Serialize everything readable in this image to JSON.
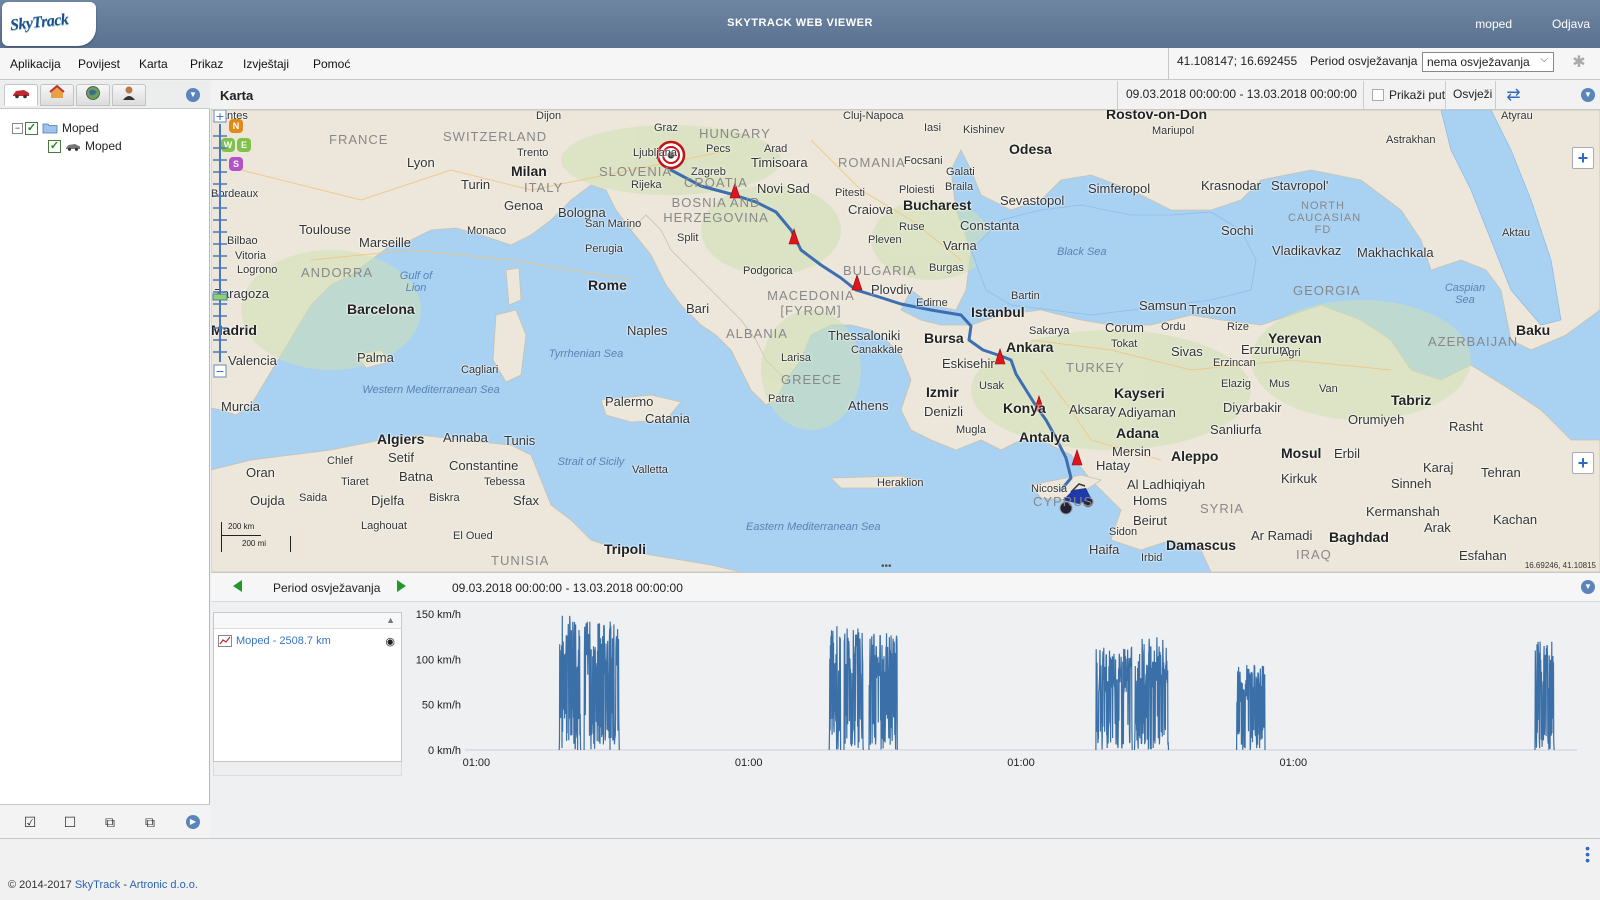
{
  "header": {
    "logo_text": "SkyTrack",
    "title": "SKYTRACK WEB VIEWER",
    "user": "moped",
    "logout": "Odjava"
  },
  "menu": {
    "items": [
      "Aplikacija",
      "Povijest",
      "Karta",
      "Prikaz",
      "Izvještaji",
      "Pomoć"
    ],
    "coordinates": "41.108147; 16.692455",
    "refresh_label": "Period osvježavanja",
    "refresh_value": "nema osvježavanja"
  },
  "left_panel": {
    "tabs": [
      "vehicles-tab",
      "places-tab",
      "zones-tab",
      "users-tab"
    ],
    "tree": {
      "group": "Moped",
      "vehicle": "Moped"
    }
  },
  "map_panel": {
    "title": "Karta",
    "period": "09.03.2018 00:00:00 - 13.03.2018 00:00:00",
    "show_path_label": "Prikaži put",
    "refresh_button": "Osvježi",
    "scale_km": "200 km",
    "scale_mi": "200 mi",
    "cursor_coords": "16.69246, 41.10815",
    "compass": [
      "N",
      "W",
      "E",
      "S"
    ],
    "labels": {
      "cities": [
        "Nantes",
        "Dijon",
        "Graz",
        "Cluj-Napoca",
        "Iasi",
        "Kishinev",
        "Odesa",
        "Rostov-on-Don",
        "Mariupol",
        "Atyrau",
        "Astrakhan",
        "Lyon",
        "Milan",
        "Trento",
        "Ljubljana",
        "Rijeka",
        "Zagreb",
        "Pecs",
        "Arad",
        "Timisoara",
        "Focsani",
        "Galati",
        "Braila",
        "Turin",
        "Genoa",
        "Bologna",
        "San Marino",
        "Novi Sad",
        "Pitesti",
        "Ploiesti",
        "Craiova",
        "Bucharest",
        "Constanta",
        "Sevastopol",
        "Simferopol",
        "Krasnodar",
        "Stavropol'",
        "Bordeaux",
        "Toulouse",
        "Marseille",
        "Monaco",
        "Split",
        "Pleven",
        "Ruse",
        "Varna",
        "Sochi",
        "Vladikavkaz",
        "Makhachkala",
        "Aktau",
        "Bilbao",
        "Vitoria",
        "Logrono",
        "Perugia",
        "Podgorica",
        "Burgas",
        "Zaragoza",
        "Rome",
        "Plovdiv",
        "Edirne",
        "Bartin",
        "Samsun",
        "Trabzon",
        "Barcelona",
        "Bari",
        "Istanbul",
        "Corum",
        "Ordu",
        "Rize",
        "Madrid",
        "Naples",
        "Thessaloniki",
        "Canakkale",
        "Sakarya",
        "Tokat",
        "Sivas",
        "Erzurum",
        "Yerevan",
        "Baku",
        "Valencia",
        "Palma",
        "Larisa",
        "Bursa",
        "Ankara",
        "Erzincan",
        "Agri",
        "Eskisehir",
        "Cagliari",
        "Izmir",
        "Usak",
        "Kayseri",
        "Elazig",
        "Mus",
        "Van",
        "Murcia",
        "Palermo",
        "Patra",
        "Athens",
        "Denizli",
        "Konya",
        "Aksaray",
        "Adiyaman",
        "Diyarbakir",
        "Tabriz",
        "Catania",
        "Mugla",
        "Antalya",
        "Adana",
        "Sanliurfa",
        "Orumiyeh",
        "Rasht",
        "Algiers",
        "Annaba",
        "Tunis",
        "Mersin",
        "Hatay",
        "Aleppo",
        "Mosul",
        "Erbil",
        "Karaj",
        "Tehran",
        "Oran",
        "Chlef",
        "Setif",
        "Batna",
        "Constantine",
        "Valletta",
        "Kirkuk",
        "Sinneh",
        "Tiaret",
        "Tebessa",
        "Heraklion",
        "Nicosia",
        "Al Ladhiqiyah",
        "Oujda",
        "Saida",
        "Djelfa",
        "Biskra",
        "Sfax",
        "Homs",
        "Kermanshah",
        "Arak",
        "Kachan",
        "Laghouat",
        "El Oued",
        "Beirut",
        "Sidon",
        "Haifa",
        "Damascus",
        "Irbid",
        "Ar Ramadi",
        "Baghdad",
        "Esfahan",
        "Tripoli"
      ],
      "countries": [
        "FRANCE",
        "SWITZERLAND",
        "HUNGARY",
        "ROMANIA",
        "ITALY",
        "SLOVENIA",
        "CROATIA",
        "BOSNIA AND HERZEGOVINA",
        "ANDORRA",
        "BULGARIA",
        "MACEDONIA [FYROM]",
        "ALBANIA",
        "GREECE",
        "TURKEY",
        "GEORGIA",
        "AZERBAIJAN",
        "NORTH CAUCASIAN FD",
        "SYRIA",
        "IRAQ",
        "TUNISIA",
        "CYPRUS"
      ],
      "seas": [
        "Gulf of Lion",
        "Tyrrhenian Sea",
        "Western Mediterranean Sea",
        "Strait of Sicily",
        "Eastern Mediterranean Sea",
        "Black Sea",
        "Caspian Sea"
      ]
    }
  },
  "chart_panel": {
    "period_label": "Period osvježavanja",
    "period": "09.03.2018 00:00:00 - 13.03.2018 00:00:00",
    "legend_entry": "Moped - 2508.7 km"
  },
  "chart_data": {
    "type": "line",
    "title": "",
    "xlabel": "",
    "ylabel": "",
    "y_ticks": [
      "0 km/h",
      "50 km/h",
      "100 km/h",
      "150 km/h"
    ],
    "ylim": [
      0,
      150
    ],
    "x_ticks": [
      "01:00",
      "01:00",
      "01:00",
      "01:00"
    ],
    "x_tick_hours": [
      1,
      25,
      49,
      73
    ],
    "xlim_hours": [
      0,
      98
    ],
    "series": [
      {
        "name": "Moped",
        "color": "#3a6fa8",
        "driving_segments_hours": [
          [
            8.3,
            10.2,
            150
          ],
          [
            10.5,
            13.6,
            142
          ],
          [
            32.1,
            33.1,
            145
          ],
          [
            33.4,
            35.1,
            135
          ],
          [
            35.6,
            38.1,
            130
          ],
          [
            55.6,
            58.8,
            115
          ],
          [
            59.0,
            62.0,
            125
          ],
          [
            68.0,
            70.5,
            95
          ],
          [
            94.3,
            96.0,
            120
          ]
        ]
      }
    ]
  },
  "footer": {
    "copyright_prefix": "© 2014-2017 ",
    "brand": "SkyTrack",
    "separator": " - ",
    "company": "Artronic d.o.o."
  },
  "colors": {
    "header": "#6a82a0",
    "accent": "#2c6cc0",
    "route": "#3d6fb0",
    "marker": "#e0141c",
    "sea": "#a8d1f2",
    "land": "#ede8dc"
  }
}
